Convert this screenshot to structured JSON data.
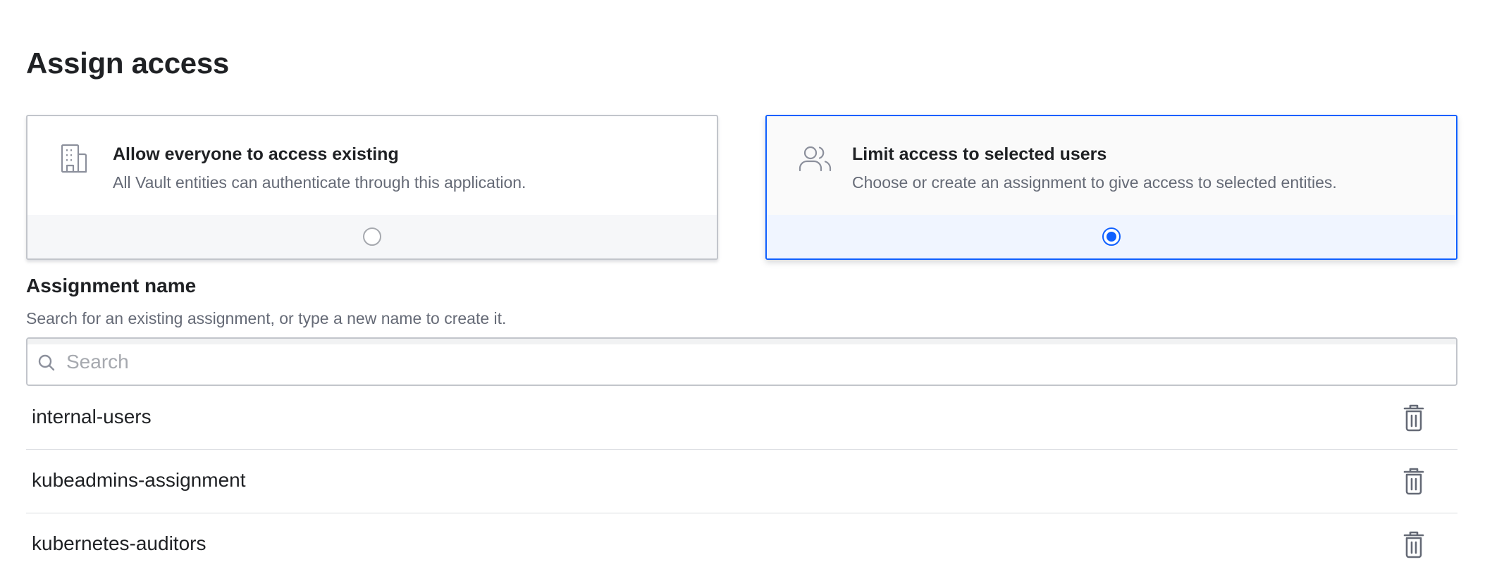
{
  "page": {
    "title": "Assign access"
  },
  "access_options": [
    {
      "title": "Allow everyone to access existing",
      "description": "All Vault entities can authenticate through this application.",
      "icon": "building-icon",
      "selected": false
    },
    {
      "title": "Limit access to selected users",
      "description": "Choose or create an assignment to give access to selected entities.",
      "icon": "users-icon",
      "selected": true
    }
  ],
  "assignment_field": {
    "label": "Assignment name",
    "help_text": "Search for an existing assignment, or type a new name to create it.",
    "search": {
      "placeholder": "Search",
      "value": ""
    }
  },
  "assignments": [
    {
      "name": "internal-users"
    },
    {
      "name": "kubeadmins-assignment"
    },
    {
      "name": "kubernetes-auditors"
    }
  ],
  "colors": {
    "accent": "#1060ff",
    "text_primary": "#1f2124",
    "text_secondary": "#656a76",
    "border": "#c2c5cb"
  }
}
